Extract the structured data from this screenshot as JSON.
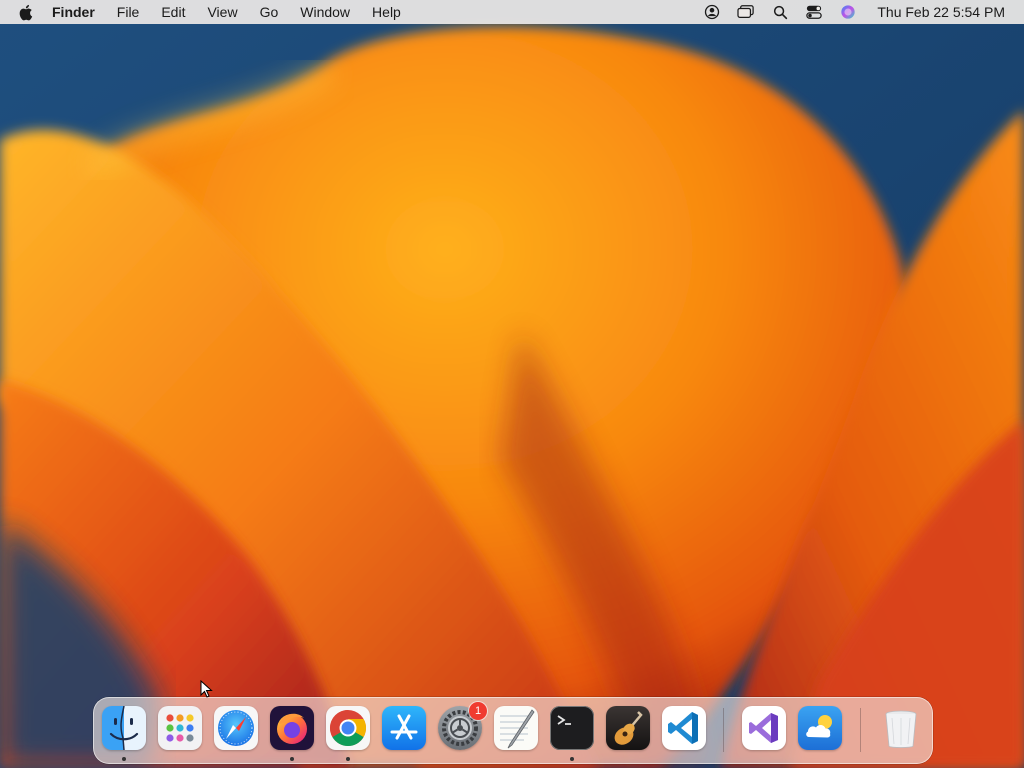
{
  "menubar": {
    "app_name": "Finder",
    "items": [
      "File",
      "Edit",
      "View",
      "Go",
      "Window",
      "Help"
    ],
    "clock": "Thu Feb 22  5:54 PM"
  },
  "dock": {
    "apps": [
      {
        "name": "Finder",
        "icon": "finder-icon",
        "running": true
      },
      {
        "name": "Launchpad",
        "icon": "launchpad-icon",
        "running": false
      },
      {
        "name": "Safari",
        "icon": "safari-icon",
        "running": false
      },
      {
        "name": "Firefox",
        "icon": "firefox-icon",
        "running": true
      },
      {
        "name": "Google Chrome",
        "icon": "chrome-icon",
        "running": true
      },
      {
        "name": "App Store",
        "icon": "app-store-icon",
        "running": false
      },
      {
        "name": "System Settings",
        "icon": "system-settings-icon",
        "running": false,
        "badge": "1"
      },
      {
        "name": "TextEdit",
        "icon": "textedit-icon",
        "running": false
      },
      {
        "name": "Terminal",
        "icon": "terminal-icon",
        "running": true
      },
      {
        "name": "GarageBand",
        "icon": "garageband-icon",
        "running": false
      },
      {
        "name": "Visual Studio Code",
        "icon": "vscode-icon",
        "running": false
      },
      {
        "name": "Visual Studio",
        "icon": "visual-studio-icon",
        "running": false
      },
      {
        "name": "Weather",
        "icon": "weather-icon",
        "running": false
      },
      {
        "name": "Trash",
        "icon": "trash-icon",
        "running": false
      }
    ]
  },
  "colors": {
    "wallpaper_blue": "#1d4a78",
    "wallpaper_orange": "#f78a12",
    "badge_red": "#f03b30"
  }
}
